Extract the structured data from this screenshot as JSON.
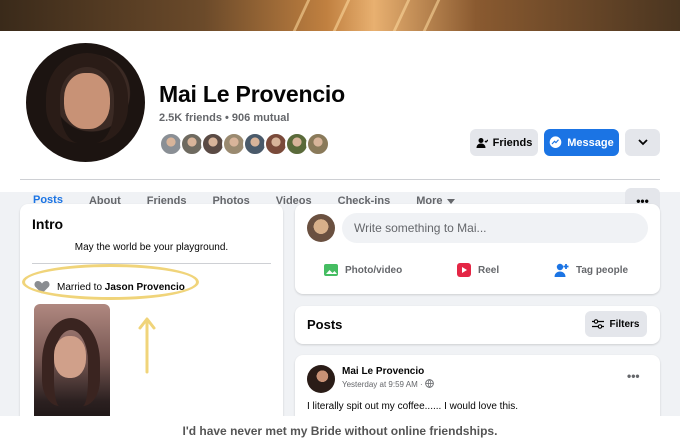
{
  "profile": {
    "name": "Mai Le Provencio",
    "friend_counts": "2.5K friends • 906 mutual",
    "mutual_avatar_colors": [
      "#8a8f95",
      "#6e6a60",
      "#5a4a44",
      "#9a8a70",
      "#4a5a6a",
      "#7a4a3a",
      "#5a6a3a",
      "#8a7a5a"
    ]
  },
  "actions": {
    "friends_label": "Friends",
    "message_label": "Message"
  },
  "tabs": [
    {
      "label": "Posts"
    },
    {
      "label": "About"
    },
    {
      "label": "Friends"
    },
    {
      "label": "Photos"
    },
    {
      "label": "Videos"
    },
    {
      "label": "Check-ins"
    },
    {
      "label": "More"
    }
  ],
  "intro": {
    "title": "Intro",
    "bio": "May the world be your playground.",
    "married_prefix": "Married to",
    "married_name": "Jason Provencio"
  },
  "composer": {
    "placeholder": "Write something to Mai...",
    "actions": [
      {
        "label": "Photo/video",
        "icon": "photo-icon",
        "color": "#45bd62"
      },
      {
        "label": "Reel",
        "icon": "reel-icon",
        "color": "#e42645"
      },
      {
        "label": "Tag people",
        "icon": "tag-people-icon",
        "color": "#1b74e4"
      }
    ]
  },
  "posts": {
    "title": "Posts",
    "filters_label": "Filters",
    "items": [
      {
        "author": "Mai Le Provencio",
        "time": "Yesterday at 9:59 AM ·",
        "text": "I literally spit out my coffee...... I would love this."
      }
    ]
  },
  "caption": "I'd have never met my Bride without online friendships.",
  "colors": {
    "accent": "#1b74e4",
    "highlight": "#f0d47a"
  }
}
